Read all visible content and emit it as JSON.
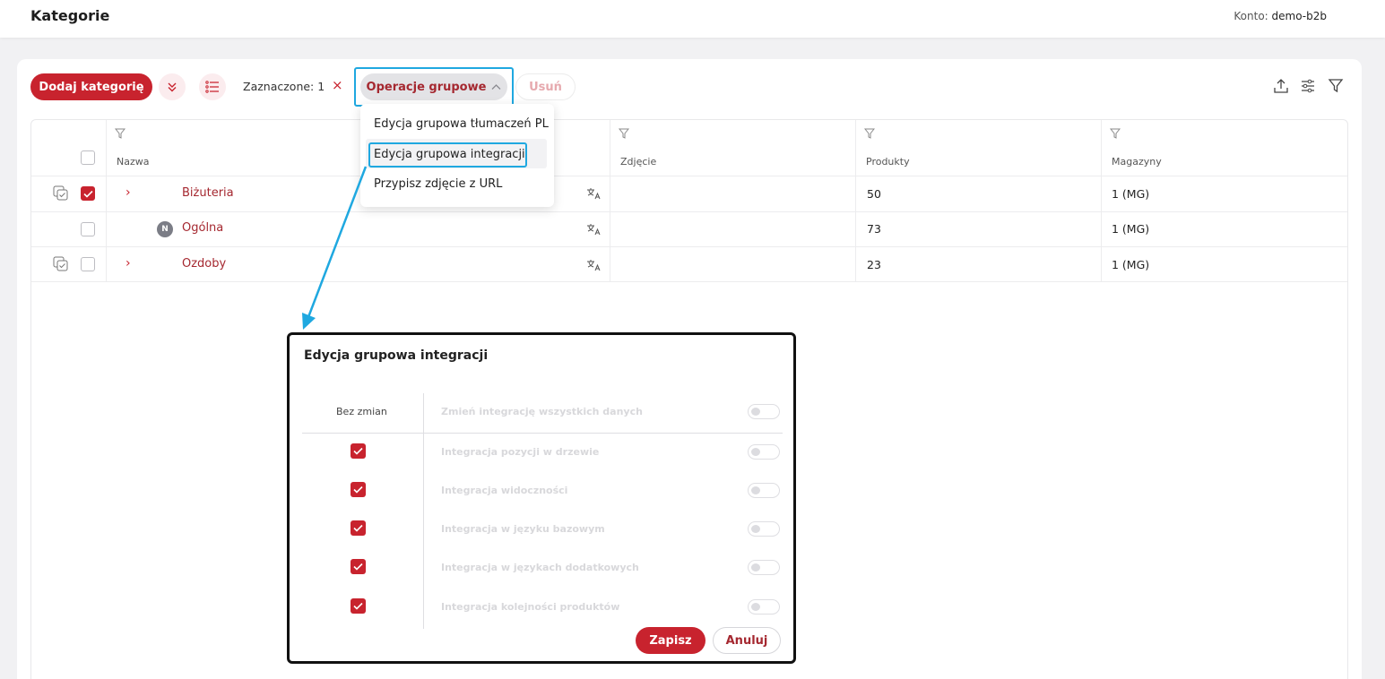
{
  "header": {
    "title": "Kategorie",
    "account_label": "Konto:",
    "account_value": "demo-b2b"
  },
  "toolbar": {
    "add_label": "Dodaj kategorię",
    "selected_label": "Zaznaczone: 1",
    "clear_symbol": "×",
    "group_ops_label": "Operacje grupowe",
    "delete_label": "Usuń"
  },
  "dropdown": {
    "items": [
      {
        "label": "Edycja grupowa tłumaczeń PL"
      },
      {
        "label": "Edycja grupowa integracji"
      },
      {
        "label": "Przypisz zdjęcie z URL"
      }
    ]
  },
  "table": {
    "columns": [
      "Nazwa",
      "Zdjęcie",
      "Produkty",
      "Magazyny"
    ],
    "rows": [
      {
        "name": "Biżuteria",
        "expandable": true,
        "checked": true,
        "badge": "",
        "products": "50",
        "warehouses": "1 (MG)"
      },
      {
        "name": "Ogólna",
        "expandable": false,
        "checked": false,
        "badge": "N",
        "products": "73",
        "warehouses": "1 (MG)"
      },
      {
        "name": "Ozdoby",
        "expandable": true,
        "checked": false,
        "badge": "",
        "products": "23",
        "warehouses": "1 (MG)"
      }
    ]
  },
  "dialog": {
    "title": "Edycja grupowa integracji",
    "no_change_label": "Bez zmian",
    "master_option": "Zmień integrację wszystkich danych",
    "options": [
      {
        "label": "Integracja pozycji w drzewie",
        "no_change": true,
        "enabled": false
      },
      {
        "label": "Integracja widoczności",
        "no_change": true,
        "enabled": false
      },
      {
        "label": "Integracja w języku bazowym",
        "no_change": true,
        "enabled": false
      },
      {
        "label": "Integracja w językach dodatkowych",
        "no_change": true,
        "enabled": false
      },
      {
        "label": "Integracja kolejności produktów",
        "no_change": true,
        "enabled": false
      }
    ],
    "save_label": "Zapisz",
    "cancel_label": "Anuluj"
  },
  "colors": {
    "accent": "#c8232e",
    "link": "#a52830",
    "highlight": "#1fa8e0"
  }
}
